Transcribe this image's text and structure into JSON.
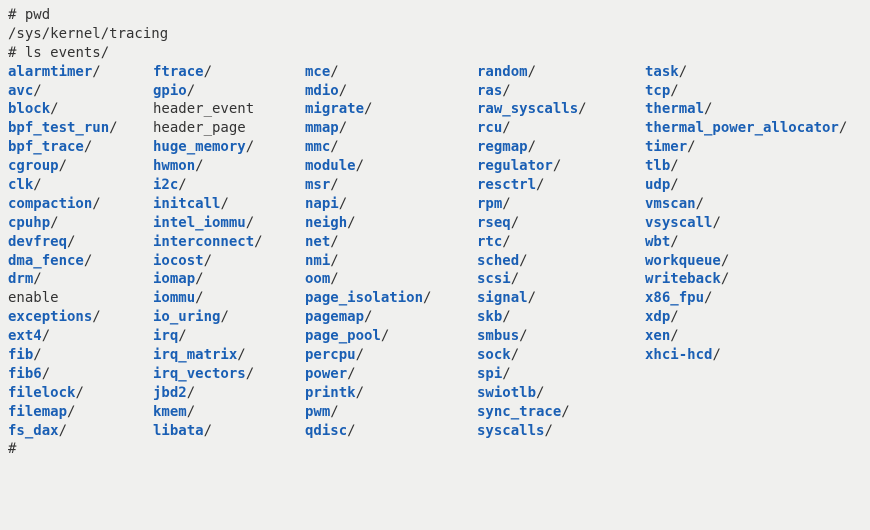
{
  "prompt_char": "#",
  "cmd1": "pwd",
  "pwd_output": "/sys/kernel/tracing",
  "cmd2": "ls events/",
  "columns": [
    [
      {
        "name": "alarmtimer",
        "type": "dir"
      },
      {
        "name": "avc",
        "type": "dir"
      },
      {
        "name": "block",
        "type": "dir"
      },
      {
        "name": "bpf_test_run",
        "type": "dir"
      },
      {
        "name": "bpf_trace",
        "type": "dir"
      },
      {
        "name": "cgroup",
        "type": "dir"
      },
      {
        "name": "clk",
        "type": "dir"
      },
      {
        "name": "compaction",
        "type": "dir"
      },
      {
        "name": "cpuhp",
        "type": "dir"
      },
      {
        "name": "devfreq",
        "type": "dir"
      },
      {
        "name": "dma_fence",
        "type": "dir"
      },
      {
        "name": "drm",
        "type": "dir"
      },
      {
        "name": "enable",
        "type": "file"
      },
      {
        "name": "exceptions",
        "type": "dir"
      },
      {
        "name": "ext4",
        "type": "dir"
      },
      {
        "name": "fib",
        "type": "dir"
      },
      {
        "name": "fib6",
        "type": "dir"
      },
      {
        "name": "filelock",
        "type": "dir"
      },
      {
        "name": "filemap",
        "type": "dir"
      },
      {
        "name": "fs_dax",
        "type": "dir"
      }
    ],
    [
      {
        "name": "ftrace",
        "type": "dir"
      },
      {
        "name": "gpio",
        "type": "dir"
      },
      {
        "name": "header_event",
        "type": "file"
      },
      {
        "name": "header_page",
        "type": "file"
      },
      {
        "name": "huge_memory",
        "type": "dir"
      },
      {
        "name": "hwmon",
        "type": "dir"
      },
      {
        "name": "i2c",
        "type": "dir"
      },
      {
        "name": "initcall",
        "type": "dir"
      },
      {
        "name": "intel_iommu",
        "type": "dir"
      },
      {
        "name": "interconnect",
        "type": "dir"
      },
      {
        "name": "iocost",
        "type": "dir"
      },
      {
        "name": "iomap",
        "type": "dir"
      },
      {
        "name": "iommu",
        "type": "dir"
      },
      {
        "name": "io_uring",
        "type": "dir"
      },
      {
        "name": "irq",
        "type": "dir"
      },
      {
        "name": "irq_matrix",
        "type": "dir"
      },
      {
        "name": "irq_vectors",
        "type": "dir"
      },
      {
        "name": "jbd2",
        "type": "dir"
      },
      {
        "name": "kmem",
        "type": "dir"
      },
      {
        "name": "libata",
        "type": "dir"
      }
    ],
    [
      {
        "name": "mce",
        "type": "dir"
      },
      {
        "name": "mdio",
        "type": "dir"
      },
      {
        "name": "migrate",
        "type": "dir"
      },
      {
        "name": "mmap",
        "type": "dir"
      },
      {
        "name": "mmc",
        "type": "dir"
      },
      {
        "name": "module",
        "type": "dir"
      },
      {
        "name": "msr",
        "type": "dir"
      },
      {
        "name": "napi",
        "type": "dir"
      },
      {
        "name": "neigh",
        "type": "dir"
      },
      {
        "name": "net",
        "type": "dir"
      },
      {
        "name": "nmi",
        "type": "dir"
      },
      {
        "name": "oom",
        "type": "dir"
      },
      {
        "name": "page_isolation",
        "type": "dir"
      },
      {
        "name": "pagemap",
        "type": "dir"
      },
      {
        "name": "page_pool",
        "type": "dir"
      },
      {
        "name": "percpu",
        "type": "dir"
      },
      {
        "name": "power",
        "type": "dir"
      },
      {
        "name": "printk",
        "type": "dir"
      },
      {
        "name": "pwm",
        "type": "dir"
      },
      {
        "name": "qdisc",
        "type": "dir"
      }
    ],
    [
      {
        "name": "random",
        "type": "dir"
      },
      {
        "name": "ras",
        "type": "dir"
      },
      {
        "name": "raw_syscalls",
        "type": "dir"
      },
      {
        "name": "rcu",
        "type": "dir"
      },
      {
        "name": "regmap",
        "type": "dir"
      },
      {
        "name": "regulator",
        "type": "dir"
      },
      {
        "name": "resctrl",
        "type": "dir"
      },
      {
        "name": "rpm",
        "type": "dir"
      },
      {
        "name": "rseq",
        "type": "dir"
      },
      {
        "name": "rtc",
        "type": "dir"
      },
      {
        "name": "sched",
        "type": "dir"
      },
      {
        "name": "scsi",
        "type": "dir"
      },
      {
        "name": "signal",
        "type": "dir"
      },
      {
        "name": "skb",
        "type": "dir"
      },
      {
        "name": "smbus",
        "type": "dir"
      },
      {
        "name": "sock",
        "type": "dir"
      },
      {
        "name": "spi",
        "type": "dir"
      },
      {
        "name": "swiotlb",
        "type": "dir"
      },
      {
        "name": "sync_trace",
        "type": "dir"
      },
      {
        "name": "syscalls",
        "type": "dir"
      }
    ],
    [
      {
        "name": "task",
        "type": "dir"
      },
      {
        "name": "tcp",
        "type": "dir"
      },
      {
        "name": "thermal",
        "type": "dir"
      },
      {
        "name": "thermal_power_allocator",
        "type": "dir"
      },
      {
        "name": "timer",
        "type": "dir"
      },
      {
        "name": "tlb",
        "type": "dir"
      },
      {
        "name": "udp",
        "type": "dir"
      },
      {
        "name": "vmscan",
        "type": "dir"
      },
      {
        "name": "vsyscall",
        "type": "dir"
      },
      {
        "name": "wbt",
        "type": "dir"
      },
      {
        "name": "workqueue",
        "type": "dir"
      },
      {
        "name": "writeback",
        "type": "dir"
      },
      {
        "name": "x86_fpu",
        "type": "dir"
      },
      {
        "name": "xdp",
        "type": "dir"
      },
      {
        "name": "xen",
        "type": "dir"
      },
      {
        "name": "xhci-hcd",
        "type": "dir"
      }
    ]
  ]
}
